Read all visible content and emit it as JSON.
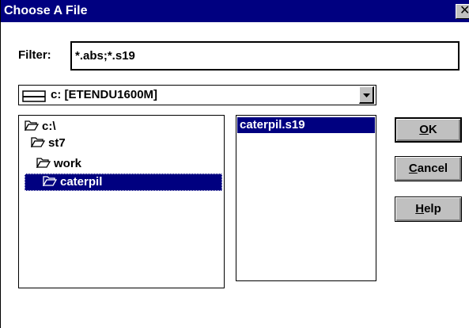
{
  "window": {
    "title": "Choose A File",
    "close_glyph": "✕"
  },
  "filter": {
    "label": "Filter:",
    "value": "*.abs;*.s19"
  },
  "drive": {
    "value": "c: [ETENDU1600M]",
    "icon": "drive-icon"
  },
  "directories": {
    "items": [
      {
        "label": "c:\\",
        "icon": "open-folder-icon",
        "selected": false
      },
      {
        "label": "st7",
        "icon": "open-folder-icon",
        "selected": false
      },
      {
        "label": "work",
        "icon": "open-folder-icon",
        "selected": false
      },
      {
        "label": "caterpil",
        "icon": "open-folder-icon",
        "selected": true
      }
    ]
  },
  "files": {
    "items": [
      {
        "label": "caterpil.s19",
        "selected": true
      }
    ]
  },
  "buttons": {
    "ok": {
      "accel": "O",
      "rest": "K"
    },
    "cancel": {
      "accel": "C",
      "rest": "ancel"
    },
    "help": {
      "accel": "H",
      "rest": "elp"
    }
  },
  "colors": {
    "titlebar": "#000080",
    "selection": "#000080",
    "button_face": "#c0c0c0"
  }
}
